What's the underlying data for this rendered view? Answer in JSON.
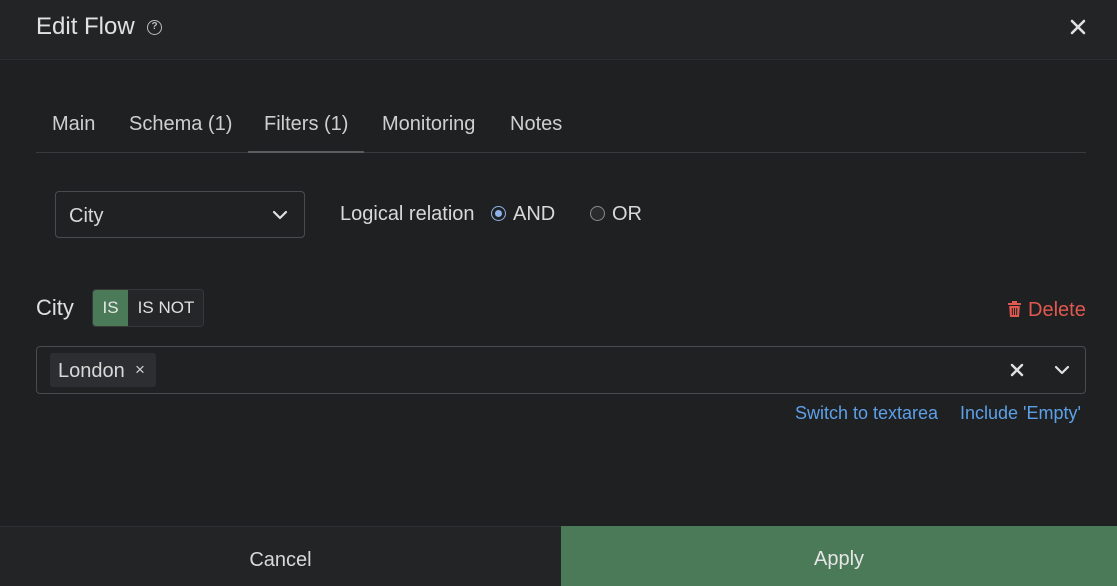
{
  "dialog": {
    "title": "Edit Flow",
    "help_icon": "question-circle-icon",
    "close_icon": "close-icon"
  },
  "tabs": [
    {
      "label": "Main",
      "active": false
    },
    {
      "label": "Schema (1)",
      "active": false
    },
    {
      "label": "Filters (1)",
      "active": true
    },
    {
      "label": "Monitoring",
      "active": false
    },
    {
      "label": "Notes",
      "active": false
    }
  ],
  "field_select": {
    "value": "City",
    "icon": "chevron-down-icon"
  },
  "logical_relation": {
    "label": "Logical relation",
    "options": [
      {
        "label": "AND",
        "checked": true
      },
      {
        "label": "OR",
        "checked": false
      }
    ]
  },
  "filter": {
    "field_label": "City",
    "operator_options": [
      "IS",
      "IS NOT"
    ],
    "selected_operator": "IS",
    "delete_label": "Delete",
    "delete_icon": "trash-icon",
    "values": [
      "London"
    ],
    "chip_remove": "×"
  },
  "links": {
    "switch_textarea": "Switch to textarea",
    "include_empty": "Include 'Empty'"
  },
  "footer": {
    "cancel_label": "Cancel",
    "apply_label": "Apply"
  },
  "colors": {
    "background": "#1f2022",
    "accent_green": "#4a7a58",
    "link_blue": "#5da0e8",
    "delete_red": "#e0584f"
  }
}
